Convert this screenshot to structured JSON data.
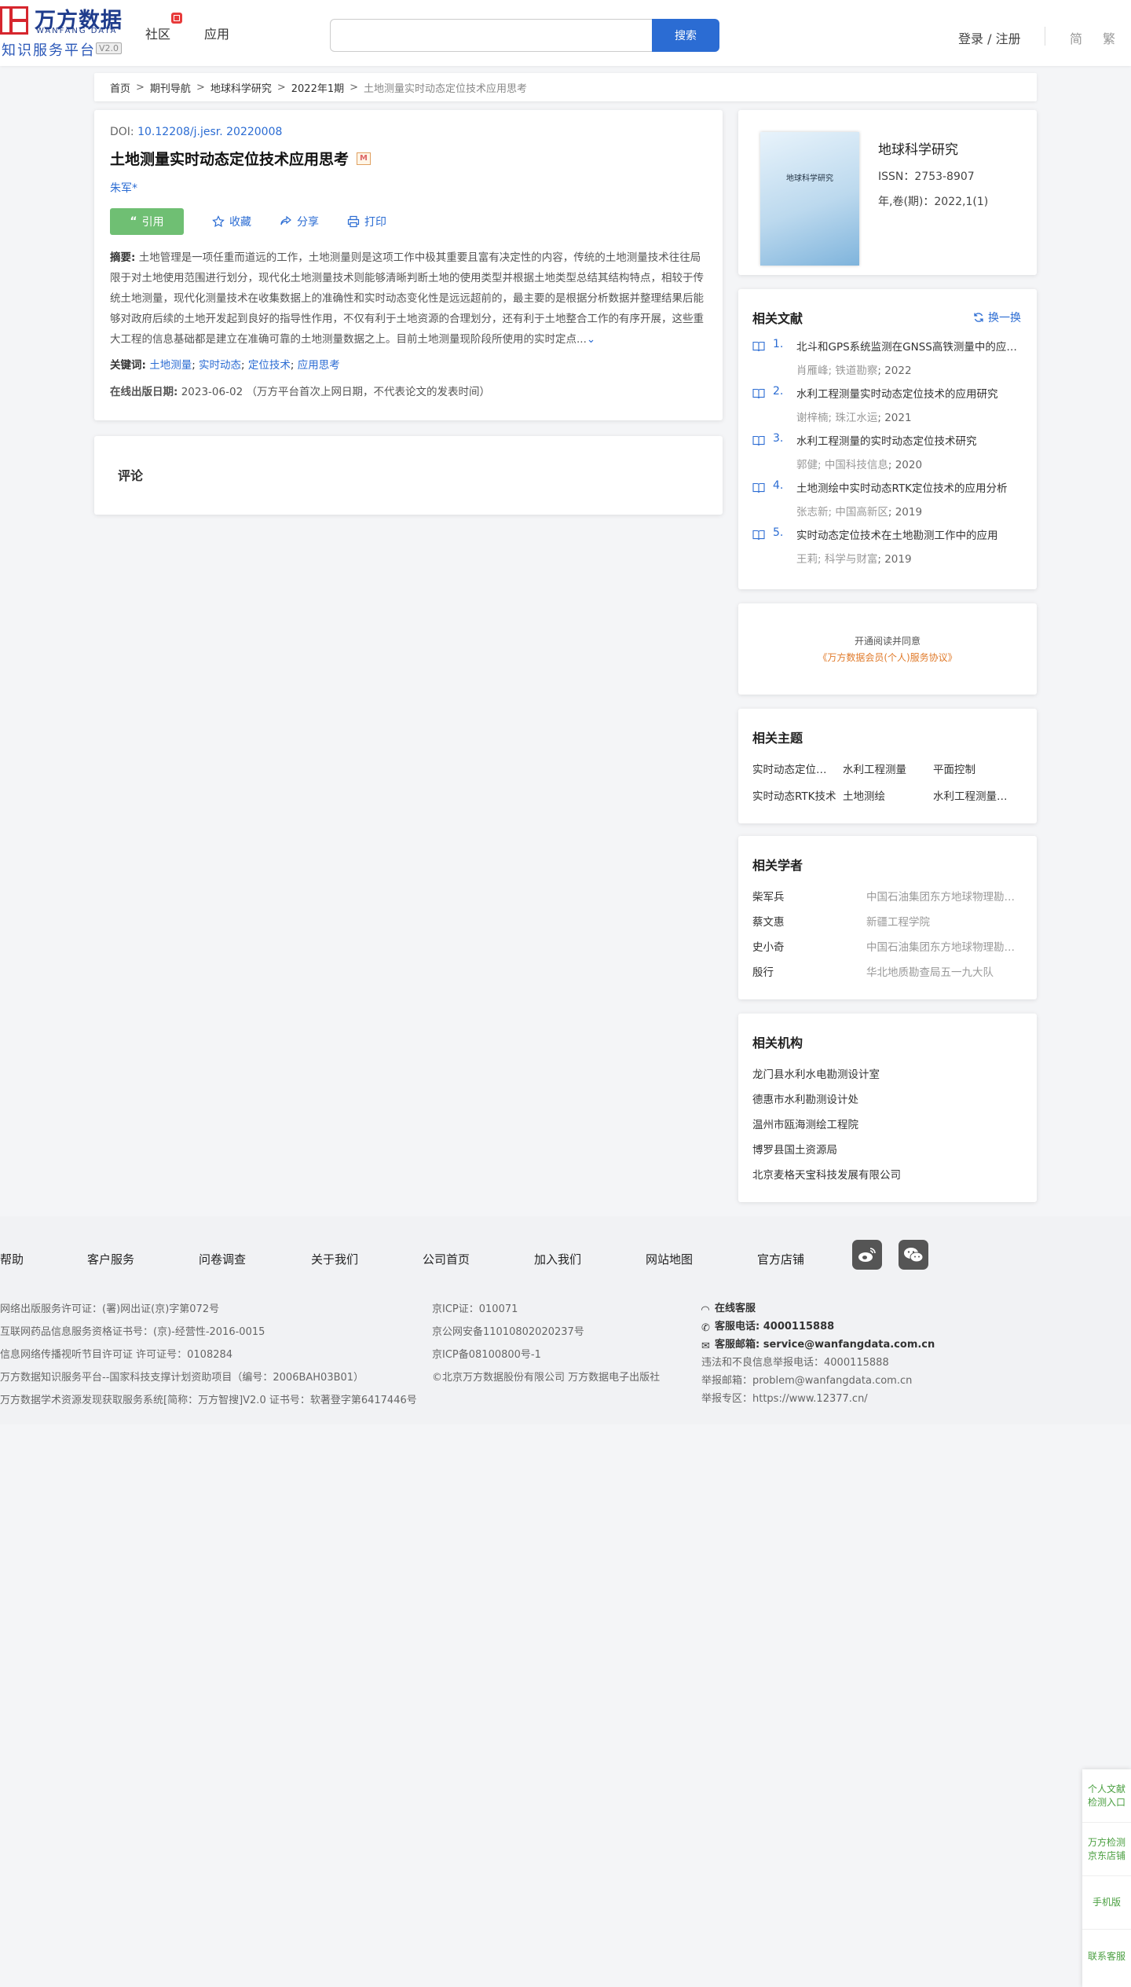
{
  "header": {
    "logo_cn": "万方数据",
    "logo_en": "WANFANG DATA",
    "logo_sub": "知识服务平台",
    "logo_ver": "V2.0",
    "nav": [
      "社区",
      "应用"
    ],
    "search_placeholder": "",
    "search_btn": "搜索",
    "login": "登录 / 注册",
    "lang_simplified": "简",
    "lang_traditional": "繁"
  },
  "breadcrumb": [
    "首页",
    "期刊导航",
    "地球科学研究",
    "2022年1期",
    "土地测量实时动态定位技术应用思考"
  ],
  "article": {
    "doi_label": "DOI:",
    "doi": "10.12208/j.jesr. 20220008",
    "title": "土地测量实时动态定位技术应用思考",
    "title_badge": "M",
    "author": "朱军*",
    "cite": "引用",
    "favorite": "收藏",
    "share": "分享",
    "print": "打印",
    "abstract_label": "摘要:",
    "abstract": "土地管理是一项任重而道远的工作，土地测量则是这项工作中极其重要且富有决定性的内容，传统的土地测量技术往往局限于对土地使用范围进行划分，现代化土地测量技术则能够清晰判断土地的使用类型并根据土地类型总结其结构特点，相较于传统土地测量，现代化测量技术在收集数据上的准确性和实时动态变化性是远远超前的，最主要的是根据分析数据并整理结果后能够对政府后续的土地开发起到良好的指导性作用，不仅有利于土地资源的合理划分，还有利于土地整合工作的有序开展，这些重大工程的信息基础都是建立在准确可靠的土地测量数据之上。目前土地测量现阶段所使用的实时定点...",
    "keywords_label": "关键词:",
    "keywords": [
      "土地测量",
      "实时动态",
      "定位技术",
      "应用思考"
    ],
    "pub_label": "在线出版日期:",
    "pub_date": "2023-06-02",
    "pub_note": "（万方平台首次上网日期，不代表论文的发表时间）"
  },
  "comments": {
    "title": "评论"
  },
  "journal": {
    "cover_text": "地球科学研究",
    "name": "地球科学研究",
    "issn": "ISSN：2753-8907",
    "vol": "年,卷(期)：2022,1(1)"
  },
  "related_docs": {
    "title": "相关文献",
    "swap": "换一换",
    "items": [
      {
        "num": "1.",
        "title": "北斗和GPS系统监测在GNSS高铁测量中的应用研究",
        "authors": "肖雁峰; 铁道勘察",
        "year": "2022"
      },
      {
        "num": "2.",
        "title": "水利工程测量实时动态定位技术的应用研究",
        "authors": "谢梓楠; 珠江水运",
        "year": "2021"
      },
      {
        "num": "3.",
        "title": "水利工程测量的实时动态定位技术研究",
        "authors": "郭健; 中国科技信息",
        "year": "2020"
      },
      {
        "num": "4.",
        "title": "土地测绘中实时动态RTK定位技术的应用分析",
        "authors": "张志新; 中国高新区",
        "year": "2019"
      },
      {
        "num": "5.",
        "title": "实时动态定位技术在土地勘测工作中的应用",
        "authors": "王莉; 科学与财富",
        "year": "2019"
      }
    ]
  },
  "agreement": {
    "line1": "开通阅读并同意",
    "line2": "《万方数据会员(个人)服务协议》"
  },
  "topics": {
    "title": "相关主题",
    "items": [
      "实时动态定位技术",
      "水利工程测量",
      "平面控制",
      "实时动态RTK技术",
      "土地测绘",
      "水利工程测量技术"
    ]
  },
  "scholars": {
    "title": "相关学者",
    "items": [
      {
        "name": "柴军兵",
        "org": "中国石油集团东方地球物理勘探有限责任公司"
      },
      {
        "name": "蔡文惠",
        "org": "新疆工程学院"
      },
      {
        "name": "史小奇",
        "org": "中国石油集团东方地球物理勘探有限责任公司"
      },
      {
        "name": "殷行",
        "org": "华北地质勘查局五一九大队"
      }
    ]
  },
  "institutions": {
    "title": "相关机构",
    "items": [
      "龙门县水利水电勘测设计室",
      "德惠市水利勘测设计处",
      "温州市瓯海测绘工程院",
      "博罗县国土资源局",
      "北京麦格天宝科技发展有限公司"
    ]
  },
  "footer": {
    "nav": [
      "帮助",
      "客户服务",
      "问卷调查",
      "关于我们",
      "公司首页",
      "加入我们",
      "网站地图",
      "官方店铺"
    ],
    "col1": [
      "网络出版服务许可证：(署)网出证(京)字第072号",
      "互联网药品信息服务资格证书号：(京)-经营性-2016-0015",
      "信息网络传播视听节目许可证 许可证号：0108284",
      "万方数据知识服务平台--国家科技支撑计划资助项目（编号：2006BAH03B01）",
      "万方数据学术资源发现获取服务系统[简称：万方智搜]V2.0 证书号：软著登字第6417446号"
    ],
    "col2": [
      "京ICP证：010071",
      "京公网安备11010802020237号",
      "京ICP备08100800号-1",
      "©北京万方数据股份有限公司 万方数据电子出版社"
    ],
    "online_service": "在线客服",
    "phone_label": "客服电话:",
    "phone": "4000115888",
    "email_label": "客服邮箱:",
    "email": "service@wanfangdata.com.cn",
    "report_phone": "违法和不良信息举报电话：4000115888",
    "report_email": "举报邮箱：problem@wanfangdata.com.cn",
    "report_area": "举报专区：https://www.12377.cn/"
  },
  "float_bar": [
    "个人文献检测入口",
    "万方检测京东店铺",
    "手机版",
    "联系客服"
  ]
}
